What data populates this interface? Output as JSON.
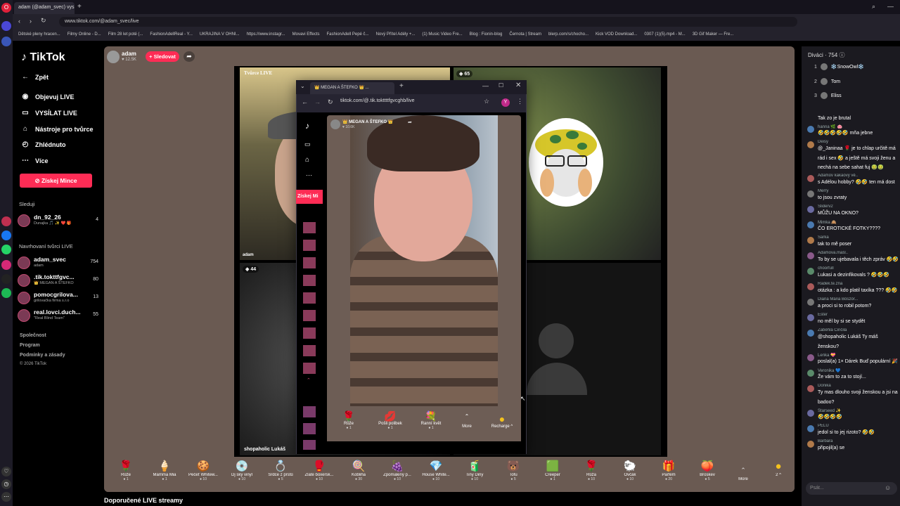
{
  "browser": {
    "tab_title": "adam (@adam_svec) vysí...",
    "url": "www.tiktok.com/@adam_svec/live",
    "bookmarks": [
      "Dětské pleny hracen...",
      "Filmy Online - D...",
      "Film 28 let poté (...",
      "FashionAdellReal - Y...",
      "UKRAJINA V OHNI...",
      "https://www.instagr...",
      "Movavi Effects",
      "FashionAdell Pepé č...",
      "Nový Přítel Adély +...",
      "(1) Music Video Fre...",
      "Blog : Fionin-blog",
      "Černota | Stream",
      "blerp.com/s/chocho...",
      "Kick VOD Download...",
      "0307 (1)(5).mp4 - M...",
      "3D Gif Maker — Fre..."
    ]
  },
  "sidebar": {
    "logo": "TikTok",
    "back": "Zpět",
    "nav": [
      "Objevuj LIVE",
      "VYSÍLAT LIVE",
      "Nástroje pro tvůrce",
      "Zhlédnuto",
      "Více"
    ],
    "coins_button": "Získej Mince",
    "following_title": "Sleduji",
    "following": [
      {
        "name": "dn_92_26",
        "sub": "Dunajka 🎵 ✨ ❤️ 🎁",
        "count": "4"
      }
    ],
    "recommended_title": "Navrhovaní tvůrci LIVE",
    "recommended": [
      {
        "name": "adam_svec",
        "sub": "adam",
        "count": "754"
      },
      {
        "name": ".tik.tokttfgvc...",
        "sub": "👑 MEGAN A ŠTEFKO",
        "count": "80"
      },
      {
        "name": "pomocgrilova...",
        "sub": "grilovačka firma s.r.o",
        "count": "13"
      },
      {
        "name": "real.lovci.duch...",
        "sub": "\"Real Blind Team\"",
        "count": "55"
      }
    ],
    "footer": [
      "Společnost",
      "Program",
      "Podmínky a zásady",
      "© 2026 TikTok"
    ]
  },
  "host": {
    "name": "adam",
    "likes": "♥ 12.5K",
    "follow_label": "+ Sledovat"
  },
  "stage": {
    "label_a": "Tvůrce LIVE",
    "name_a": "adam",
    "badge_b": "65",
    "badge_c": "44",
    "name_c": "shopaholic Lukáš"
  },
  "popup": {
    "tab_title": "👑 MEGAN A ŠTEFKO 👑 ...",
    "url": "tiktok.com/@.tik.tokttttfgvcghb/live",
    "host_name": "👑 MEGAN A ŠTEFKO 👑",
    "host_likes": "♥ 10.6K",
    "coins_short": "Získej Mi",
    "gifts": [
      {
        "icon": "🌹",
        "name": "Růže",
        "cost": "1"
      },
      {
        "icon": "💋",
        "name": "Pošli polibek",
        "cost": "1"
      },
      {
        "icon": "💐",
        "name": "Ranní květ",
        "cost": "1"
      }
    ],
    "more": "More",
    "recharge": "Recharge ^"
  },
  "gifts": [
    {
      "icon": "🌹",
      "name": "Růže",
      "cost": "1"
    },
    {
      "icon": "🍦",
      "name": "Mamma Mia",
      "cost": "1"
    },
    {
      "icon": "🍪",
      "name": "Pečeť Whitew...",
      "cost": "10"
    },
    {
      "icon": "💿",
      "name": "Dj ský vinyl",
      "cost": "10"
    },
    {
      "icon": "💍",
      "name": "Srdce z prstů",
      "cost": "5"
    },
    {
      "icon": "🥊",
      "name": "Zlaté boxersk...",
      "cost": "10"
    },
    {
      "icon": "🍭",
      "name": "Kobliha",
      "cost": "30"
    },
    {
      "icon": "🍇",
      "name": "Zpomalený p...",
      "cost": "10"
    },
    {
      "icon": "💎",
      "name": "House White...",
      "cost": "10"
    },
    {
      "icon": "🧃",
      "name": "Tiny Diny",
      "cost": "10"
    },
    {
      "icon": "🐻",
      "name": "Tofu",
      "cost": "5"
    },
    {
      "icon": "🟩",
      "name": "Creeper",
      "cost": "1"
    },
    {
      "icon": "🌹",
      "name": "Růža",
      "cost": "10"
    },
    {
      "icon": "🐑",
      "name": "Ovčák",
      "cost": "10"
    },
    {
      "icon": "🎁",
      "name": "Parfém",
      "cost": "20"
    },
    {
      "icon": "🍑",
      "name": "Broskev",
      "cost": "5"
    }
  ],
  "gifts_more": "More",
  "coin_count": "2 ^",
  "recommended_streams": "Doporučené LIVE streamy",
  "chat": {
    "viewers_title": "Diváci · 754",
    "top_viewers": [
      "❄️SnowOwl❄️",
      "Tom",
      "Eliss"
    ],
    "messages": [
      {
        "user": "",
        "text": "Tak zo je brutal"
      },
      {
        "user": "hanna 🌿 🐽",
        "text": "🤣🤣🤣🤣🤣 mňa jebne"
      },
      {
        "user": "Deisy",
        "text": "@_Janinaa 🌹 je to chlap určitě má"
      },
      {
        "user": "",
        "text": "rád i sex 🤣 a ještě má svoji ženu a"
      },
      {
        "user": "",
        "text": "nechá na sebe sahat fuj 🤢🤢"
      },
      {
        "user": "Adamův kakaový vě..",
        "text": "s Adélou hobby? 🤣🤣 ten má dost"
      },
      {
        "user": "Merry",
        "text": "to jsou zvraty"
      },
      {
        "user": "Sliderv2",
        "text": "MŮŽU NA OKNO?"
      },
      {
        "user": "Mimka 🙈",
        "text": "ČO EROTICKÉ FOTKY????"
      },
      {
        "user": "Šarka",
        "text": "tak to mě poser"
      },
      {
        "user": "Adamova.mašl..",
        "text": "To by se ujebavala i těch zpráv 🤣🤣"
      },
      {
        "user": "choorfull",
        "text": "Lukasi a dezinfikovals ? 🤣🤣🤣"
      },
      {
        "user": "Radek.te.zna",
        "text": "otázka : a kdo platil taxíka ??? 🤣🤣"
      },
      {
        "user": "Diana Mária Böször...",
        "text": "a proci si to robil potom?"
      },
      {
        "user": "Ester",
        "text": "no měl by si se stydět"
      },
      {
        "user": "Zaběhlá Činčila",
        "text": "@shopaholic Lukáš Ty máš"
      },
      {
        "user": "",
        "text": "ženskou?"
      },
      {
        "user": "Lenka 💝",
        "text": "poslal(a) 1× Dárek Buď populární 🎉"
      },
      {
        "user": "Veronika 💙",
        "text": "Že vám to za to stojí..."
      },
      {
        "user": "Donika",
        "text": "Ty mas dlouho svoji ženskou a jsi na"
      },
      {
        "user": "",
        "text": "badoo?"
      },
      {
        "user": "Starseed ✨",
        "text": "🤣🤣🤣🤣"
      },
      {
        "user": "PELU",
        "text": "jedol si to jej rizoto? 🤣🤣"
      },
      {
        "user": "Barbara",
        "text": "připojil(a) se"
      }
    ],
    "input_placeholder": "Psát..."
  }
}
